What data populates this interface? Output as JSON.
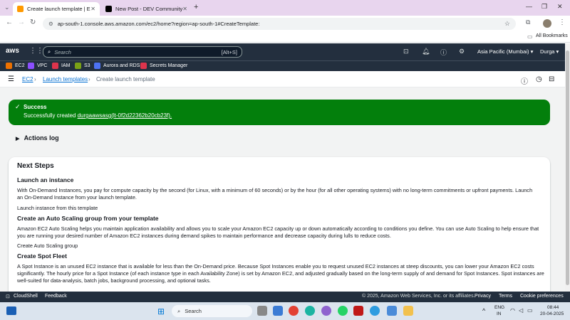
{
  "browser": {
    "tabs": [
      {
        "title": "Create launch template | EC2 | ..."
      },
      {
        "title": "New Post - DEV Community"
      }
    ],
    "url": "ap-south-1.console.aws.amazon.com/ec2/home?region=ap-south-1#CreateTemplate:",
    "bookmarks_label": "All Bookmarks"
  },
  "aws_nav": {
    "logo": "aws",
    "search_placeholder": "Search",
    "search_shortcut": "[Alt+S]",
    "region": "Asia Pacific (Mumbai)",
    "user": "Durga"
  },
  "services": [
    "EC2",
    "VPC",
    "IAM",
    "S3",
    "Aurora and RDS",
    "Secrets Manager"
  ],
  "service_colors": [
    "#ed7100",
    "#8c4fff",
    "#dd344c",
    "#7aa116",
    "#4d72f3",
    "#dd344c"
  ],
  "breadcrumb": {
    "root": "EC2",
    "parent": "Launch templates",
    "current": "Create launch template"
  },
  "flash": {
    "title": "Success",
    "message_prefix": "Successfully created",
    "template_link": "durgaawsasg(lt-0f2d22362b20cb23f)."
  },
  "actions_log": "Actions log",
  "next_steps": {
    "title": "Next Steps",
    "sections": [
      {
        "heading": "Launch an instance",
        "text": "With On-Demand Instances, you pay for compute capacity by the second (for Linux, with a minimum of 60 seconds) or by the hour (for all other operating systems) with no long-term commitments or upfront payments. Launch an On-Demand Instance from your launch template.",
        "link": "Launch instance from this template"
      },
      {
        "heading": "Create an Auto Scaling group from your template",
        "text": "Amazon EC2 Auto Scaling helps you maintain application availability and allows you to scale your Amazon EC2 capacity up or down automatically according to conditions you define. You can use Auto Scaling to help ensure that you are running your desired number of Amazon EC2 instances during demand spikes to maintain performance and decrease capacity during lulls to reduce costs.",
        "link": "Create Auto Scaling group"
      },
      {
        "heading": "Create Spot Fleet",
        "text": "A Spot Instance is an unused EC2 instance that is available for less than the On-Demand price. Because Spot Instances enable you to request unused EC2 instances at steep discounts, you can lower your Amazon EC2 costs significantly. The hourly price for a Spot Instance (of each instance type in each Availability Zone) is set by Amazon EC2, and adjusted gradually based on the long-term supply of and demand for Spot Instances. Spot instances are well-suited for data-analysis, batch jobs, background processing, and optional tasks.",
        "link": ""
      }
    ]
  },
  "footer": {
    "cloudshell": "CloudShell",
    "feedback": "Feedback",
    "copyright": "© 2025, Amazon Web Services, Inc. or its affiliates.",
    "privacy": "Privacy",
    "terms": "Terms",
    "cookies": "Cookie preferences"
  },
  "taskbar": {
    "search": "Search",
    "lang_top": "ENG",
    "lang_bottom": "IN",
    "time": "08:44",
    "date": "20-04-2025"
  }
}
